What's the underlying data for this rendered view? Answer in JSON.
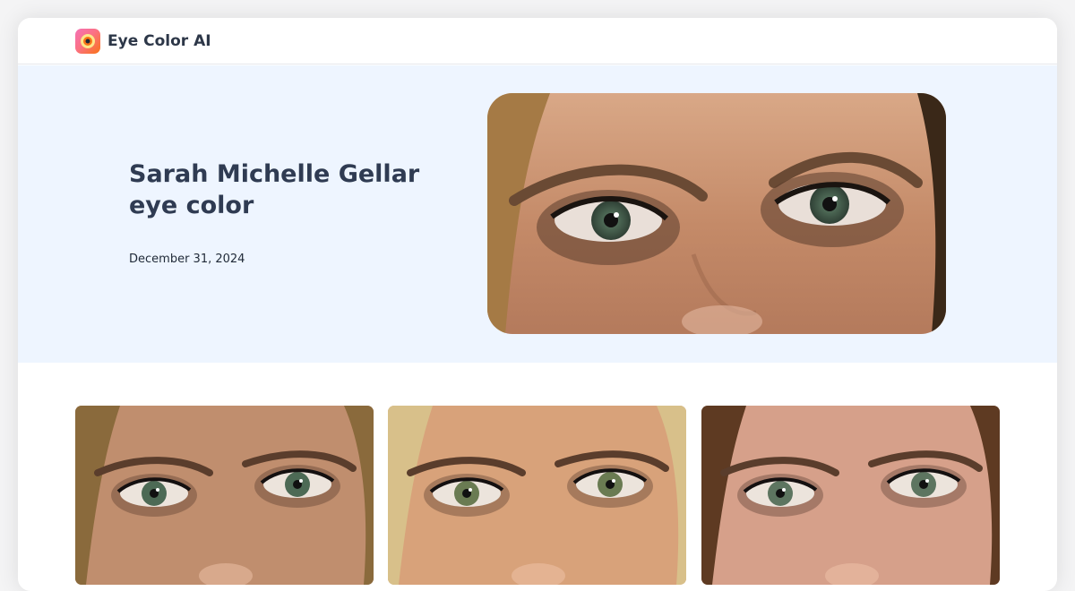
{
  "header": {
    "brand": "Eye Color AI",
    "logo_icon": "eye-logo-icon"
  },
  "hero": {
    "title": "Sarah Michelle Gellar eye color",
    "date": "December 31, 2024",
    "image_alt": "Close-up of Sarah Michelle Gellar's green eyes"
  },
  "gallery": [
    {
      "alt": "Sarah Michelle Gellar eyes close-up 1",
      "iris": "#4d6a55",
      "hair": "#8a6a3c",
      "skin": "#c08e6e"
    },
    {
      "alt": "Sarah Michelle Gellar eyes close-up 2",
      "iris": "#6a7b52",
      "hair": "#d8c08a",
      "skin": "#d8a27a"
    },
    {
      "alt": "Sarah Michelle Gellar eyes close-up 3",
      "iris": "#5d7560",
      "hair": "#5e3a22",
      "skin": "#d6a08a"
    }
  ],
  "colors": {
    "hero_bg": "#eef5ff",
    "title": "#2f3b52",
    "iris_green": "#55705c"
  }
}
